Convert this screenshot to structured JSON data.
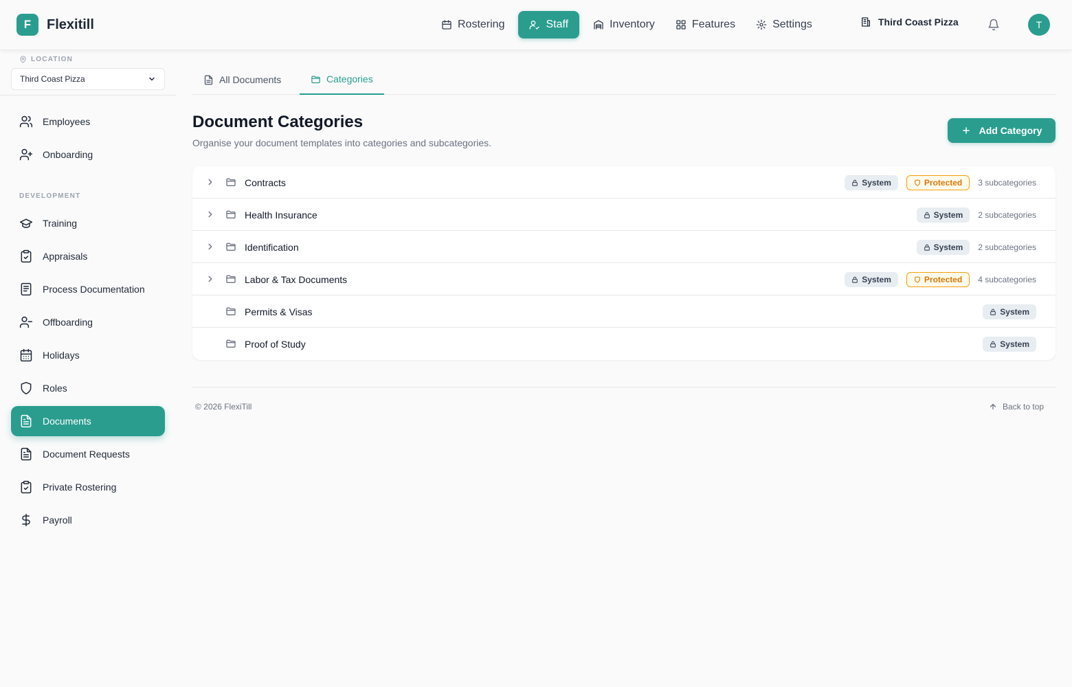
{
  "brand": {
    "logo_letter": "F",
    "name": "Flexitill"
  },
  "topnav": [
    {
      "label": "Rostering",
      "icon": "calendar-icon"
    },
    {
      "label": "Staff",
      "icon": "users-icon",
      "active": true
    },
    {
      "label": "Inventory",
      "icon": "warehouse-icon"
    },
    {
      "label": "Features",
      "icon": "grid-icon"
    },
    {
      "label": "Settings",
      "icon": "gear-icon"
    }
  ],
  "header": {
    "location_name": "Third Coast Pizza",
    "avatar_letter": "T"
  },
  "sidebar": {
    "location_label": "LOCATION",
    "location_value": "Third Coast Pizza",
    "items_top": [
      {
        "label": "Employees",
        "icon": "users-icon"
      },
      {
        "label": "Onboarding",
        "icon": "user-plus-icon"
      }
    ],
    "section_label": "DEVELOPMENT",
    "items_dev": [
      {
        "label": "Training",
        "icon": "graduation-cap-icon"
      },
      {
        "label": "Appraisals",
        "icon": "clipboard-check-icon"
      },
      {
        "label": "Process Documentation",
        "icon": "notebook-icon"
      },
      {
        "label": "Offboarding",
        "icon": "user-minus-icon"
      },
      {
        "label": "Holidays",
        "icon": "calendar-days-icon"
      },
      {
        "label": "Roles",
        "icon": "shield-icon"
      },
      {
        "label": "Documents",
        "icon": "file-text-icon",
        "active": true
      },
      {
        "label": "Document Requests",
        "icon": "file-text-icon"
      },
      {
        "label": "Private Rostering",
        "icon": "clipboard-check-icon"
      },
      {
        "label": "Payroll",
        "icon": "dollar-icon"
      }
    ]
  },
  "tabs": [
    {
      "label": "All Documents",
      "icon": "file-icon"
    },
    {
      "label": "Categories",
      "icon": "folder-icon",
      "active": true
    }
  ],
  "page": {
    "title": "Document Categories",
    "subtitle": "Organise your document templates into categories and subcategories.",
    "add_button": "Add Category"
  },
  "categories": [
    {
      "name": "Contracts",
      "expandable": true,
      "system": "System",
      "protected": "Protected",
      "subcount": "3 subcategories"
    },
    {
      "name": "Health Insurance",
      "expandable": true,
      "system": "System",
      "protected": null,
      "subcount": "2 subcategories"
    },
    {
      "name": "Identification",
      "expandable": true,
      "system": "System",
      "protected": null,
      "subcount": "2 subcategories"
    },
    {
      "name": "Labor & Tax Documents",
      "expandable": true,
      "system": "System",
      "protected": "Protected",
      "subcount": "4 subcategories"
    },
    {
      "name": "Permits & Visas",
      "expandable": false,
      "system": "System",
      "protected": null,
      "subcount": null
    },
    {
      "name": "Proof of Study",
      "expandable": false,
      "system": "System",
      "protected": null,
      "subcount": null
    }
  ],
  "footer": {
    "copyright": "© 2026 FlexiTill",
    "back_to_top": "Back to top"
  },
  "colors": {
    "accent": "#2a9d8f",
    "protected": "#d97706"
  }
}
